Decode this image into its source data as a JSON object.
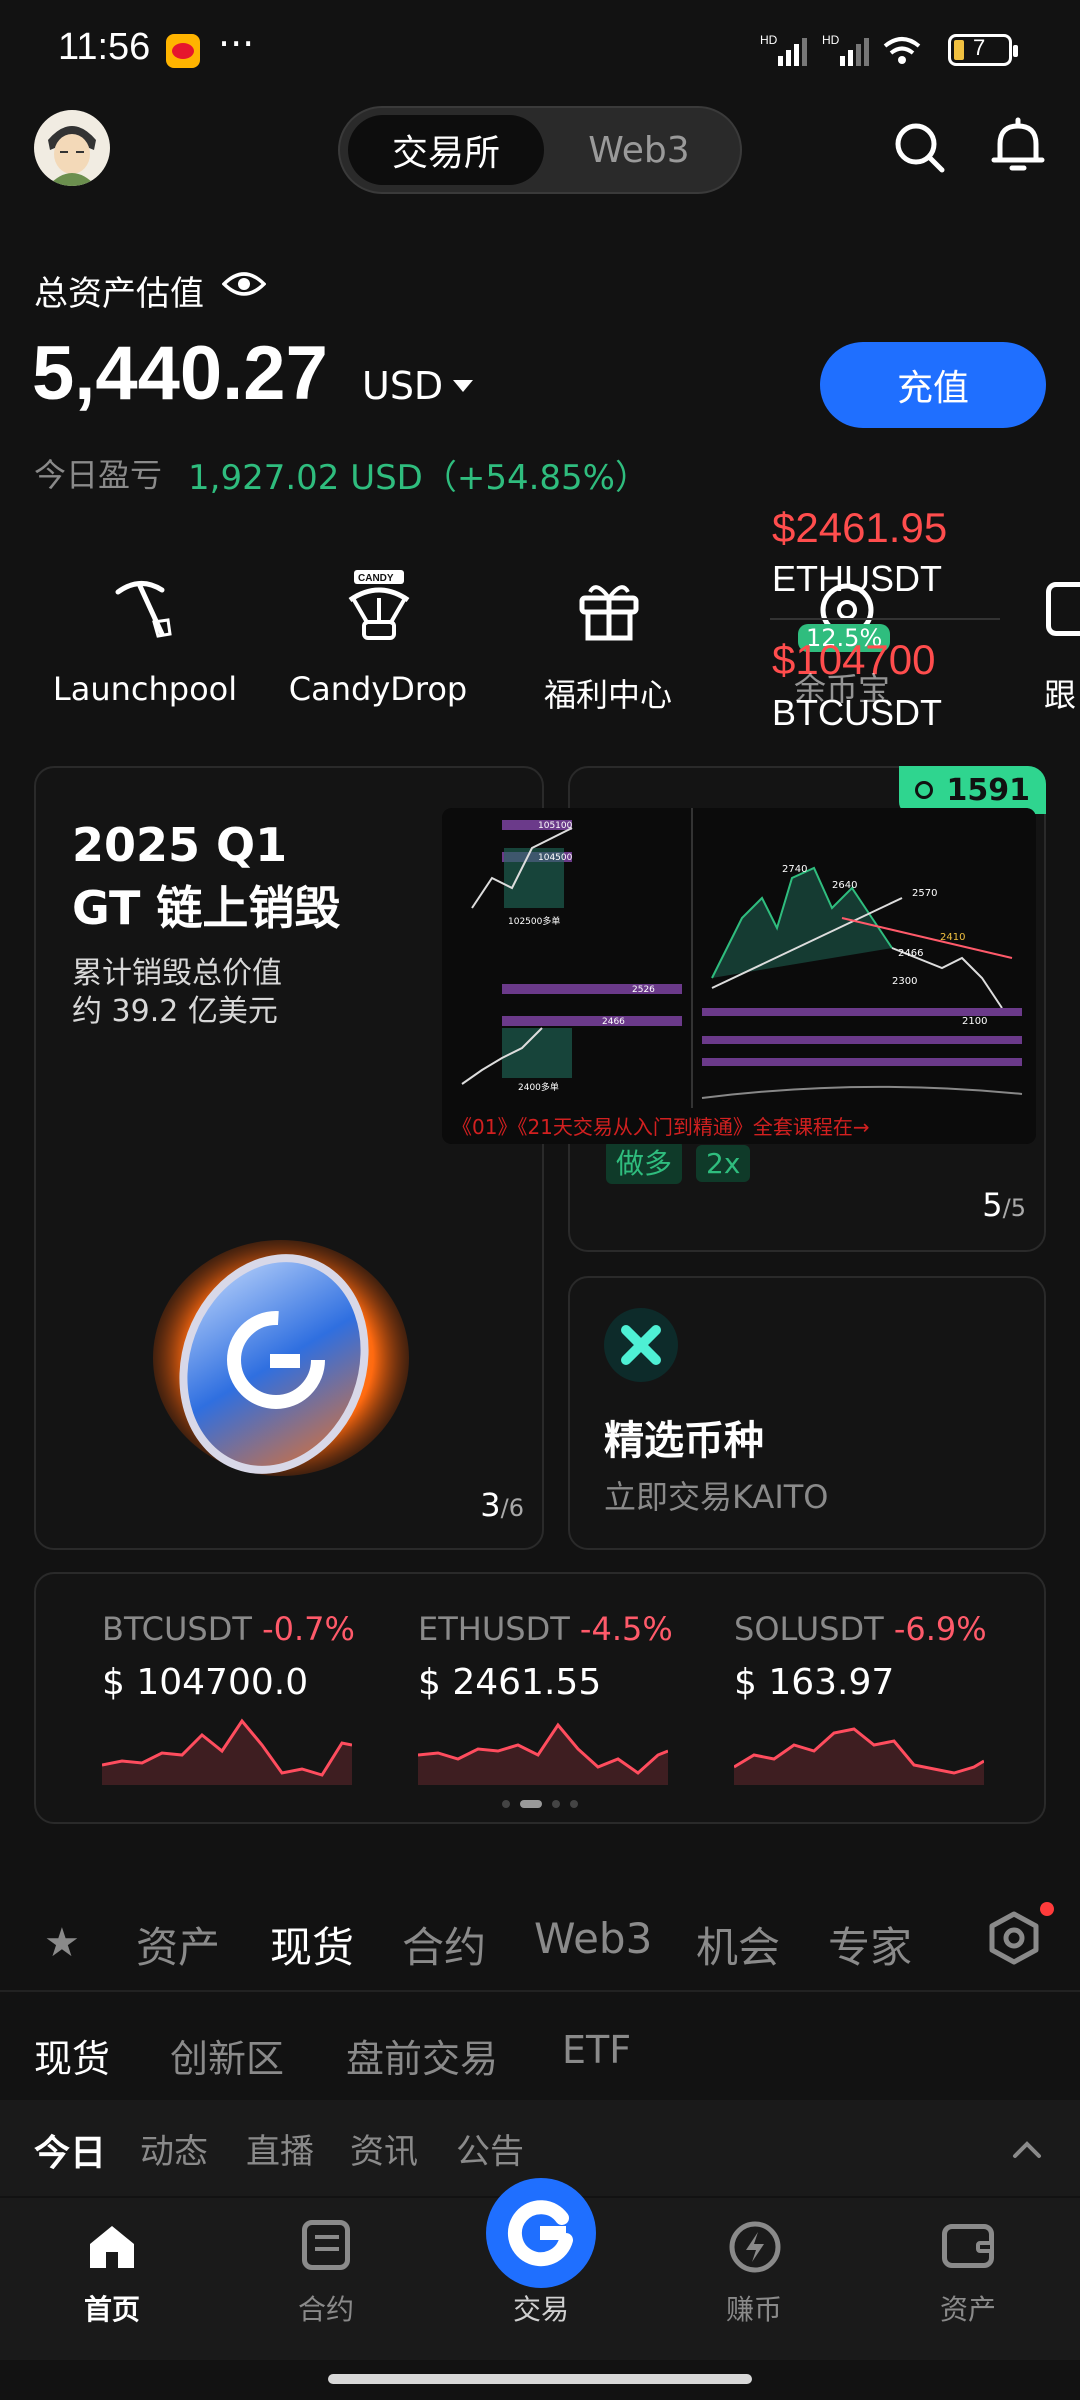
{
  "status": {
    "time": "11:56",
    "dots": "···",
    "battery": "7",
    "net1": "HD",
    "net2": "HD"
  },
  "header": {
    "tab_exchange": "交易所",
    "tab_web3": "Web3"
  },
  "asset": {
    "label": "总资产估值",
    "value": "5,440.27",
    "currency": "USD",
    "deposit_label": "充值",
    "pnl_label": "今日盈亏",
    "pnl_value": "1,927.02 USD（+54.85%）"
  },
  "overlay_prices": {
    "eth_price": "$2461.95",
    "eth_symbol": "ETHUSDT",
    "btc_price": "$104700",
    "btc_symbol": "BTCUSDT",
    "badge": "12.5%",
    "under_label": "余币宝"
  },
  "quick": [
    {
      "label": "Launchpool",
      "icon": "pickaxe-icon"
    },
    {
      "label": "CandyDrop",
      "icon": "candy-parachute-icon"
    },
    {
      "label": "福利中心",
      "icon": "gift-icon"
    },
    {
      "label": "余币宝",
      "icon": "vault-icon"
    },
    {
      "label": "跟",
      "icon": "copy-trade-icon"
    }
  ],
  "promo": {
    "title_1": "2025 Q1",
    "title_2": "GT 链上销毁",
    "sub_1": "累计销毁总价值",
    "sub_2": "约 39.2 亿美元",
    "pager_cur": "3",
    "pager_total": "/6"
  },
  "copy_card": {
    "followers": "1591",
    "tag_long": "做多",
    "tag_lev": "2x",
    "pager_cur": "5",
    "pager_total": "/5",
    "chart_caption": "《01》《21天交易从入门到精通》全套课程在→",
    "chart_labels": [
      "105100",
      "104500",
      "102500多单",
      "2526",
      "2466",
      "2400多单",
      "2740",
      "2640",
      "2570",
      "2410",
      "2466",
      "2300",
      "2100"
    ]
  },
  "featured": {
    "title": "精选币种",
    "sub": "立即交易KAITO"
  },
  "tickers": [
    {
      "symbol": "BTCUSDT",
      "change": "-0.7%",
      "price": "$ 104700.0"
    },
    {
      "symbol": "ETHUSDT",
      "change": "-4.5%",
      "price": "$ 2461.55"
    },
    {
      "symbol": "SOLUSDT",
      "change": "-6.9%",
      "price": "$ 163.97"
    }
  ],
  "market_tabs": [
    "资产",
    "现货",
    "合约",
    "Web3",
    "机会",
    "专家"
  ],
  "sub_tabs": [
    "现货",
    "创新区",
    "盘前交易",
    "ETF"
  ],
  "news_tabs": [
    "今日",
    "动态",
    "直播",
    "资讯",
    "公告"
  ],
  "bottom_nav": [
    "首页",
    "合约",
    "交易",
    "赚币",
    "资产"
  ],
  "colors": {
    "accent": "#1f6fff",
    "green": "#2fbd7e",
    "red": "#ff5a6a",
    "bg": "#121212"
  }
}
